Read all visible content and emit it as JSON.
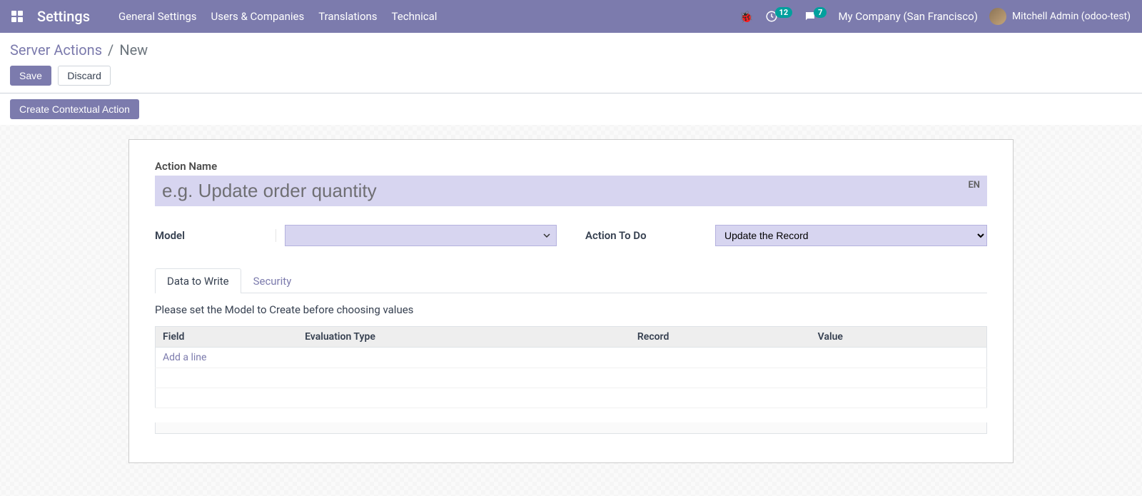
{
  "topbar": {
    "app_title": "Settings",
    "menu": [
      "General Settings",
      "Users & Companies",
      "Translations",
      "Technical"
    ],
    "activity_count": "12",
    "chat_count": "7",
    "company": "My Company (San Francisco)",
    "user": "Mitchell Admin (odoo-test)"
  },
  "breadcrumb": {
    "parent": "Server Actions",
    "current": "New",
    "save": "Save",
    "discard": "Discard"
  },
  "contextual_btn": "Create Contextual Action",
  "form": {
    "action_name_label": "Action Name",
    "action_name_placeholder": "e.g. Update order quantity",
    "action_name_value": "",
    "lang": "EN",
    "model_label": "Model",
    "model_value": "",
    "action_to_do_label": "Action To Do",
    "action_to_do_value": "Update the Record"
  },
  "tabs": {
    "data_to_write": "Data to Write",
    "security": "Security"
  },
  "data_tab": {
    "hint": "Please set the Model to Create before choosing values",
    "columns": {
      "field": "Field",
      "eval_type": "Evaluation Type",
      "record": "Record",
      "value": "Value"
    },
    "add_line": "Add a line"
  }
}
